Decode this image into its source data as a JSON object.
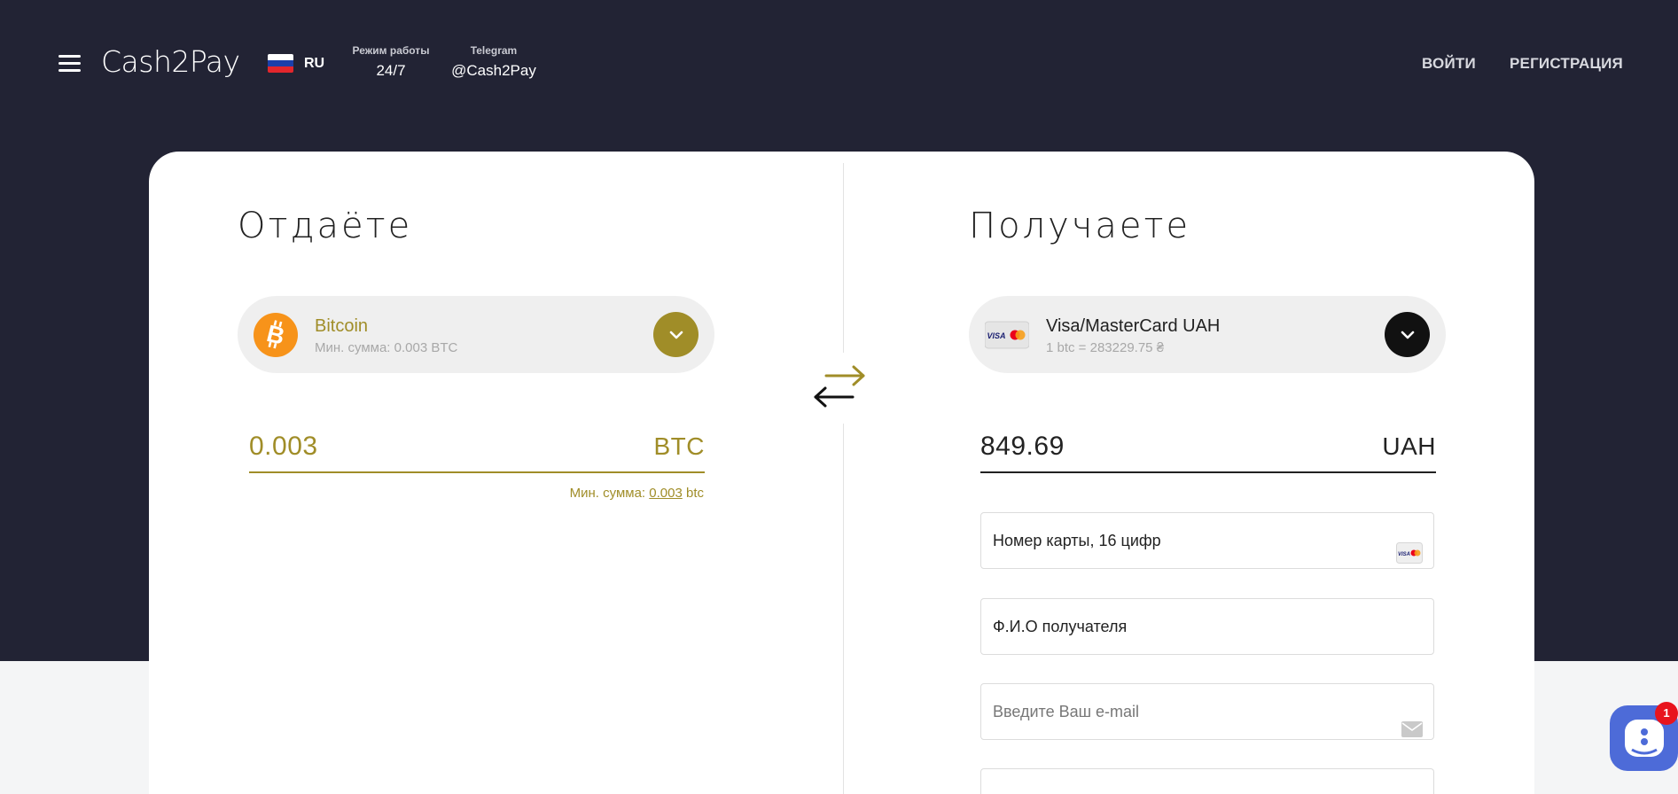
{
  "header": {
    "logo": "Cash2Pay",
    "lang": "RU",
    "schedule_caption": "Режим работы",
    "schedule_value": "24/7",
    "telegram_caption": "Telegram",
    "telegram_value": "@Cash2Pay",
    "login": "ВОЙТИ",
    "register": "РЕГИСТРАЦИЯ"
  },
  "give": {
    "title": "Отдаёте",
    "currency_name": "Bitcoin",
    "currency_sub": "Мин. сумма: 0.003 BTC",
    "amount": "0.003",
    "unit": "BTC",
    "min_prefix": "Мин. сумма: ",
    "min_value": "0.003",
    "min_suffix": " btc"
  },
  "get": {
    "title": "Получаете",
    "currency_name": "Visa/MasterCard UAH",
    "currency_sub": "1 btc = 283229.75 ₴",
    "amount": "849.69",
    "unit": "UAH",
    "card_field": "Номер карты, 16 цифр",
    "name_field": "Ф.И.О получателя",
    "email_placeholder": "Введите Ваш e-mail"
  },
  "chat": {
    "badge": "1"
  },
  "colors": {
    "header_bg": "#222334",
    "accent_gold": "#a08d28",
    "bitcoin_orange": "#f7931a",
    "chat_blue": "#4d6bd8",
    "badge_red": "#e8141d"
  },
  "icons": [
    "menu-icon",
    "ru-flag-icon",
    "bitcoin-icon",
    "chevron-down-icon",
    "visa-mastercard-icon",
    "swap-arrows-icon",
    "mail-icon",
    "chat-icon"
  ]
}
